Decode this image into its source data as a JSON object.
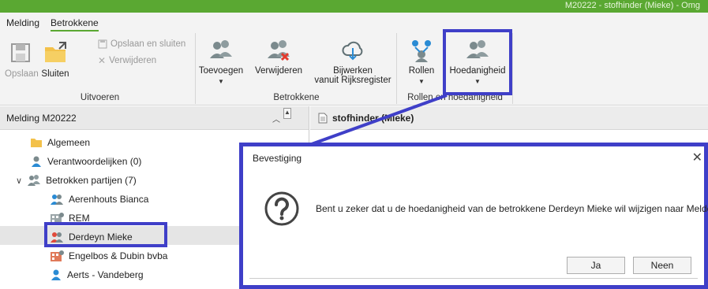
{
  "window": {
    "title": "M20222 - stofhinder (Mieke) - Omg"
  },
  "ribbon": {
    "tabs": [
      {
        "label": "Melding"
      },
      {
        "label": "Betrokkene"
      }
    ],
    "uitvoeren": {
      "group_label": "Uitvoeren",
      "opslaan": "Opslaan",
      "sluiten": "Sluiten",
      "opslaan_en_sluiten": "Opslaan en sluiten",
      "verwijderen": "Verwijderen"
    },
    "betrokkene": {
      "group_label": "Betrokkene",
      "toevoegen": "Toevoegen",
      "verwijderen": "Verwijderen",
      "bijwerken_line1": "Bijwerken",
      "bijwerken_line2": "vanuit Rijksregister"
    },
    "rollen_group": {
      "group_label": "Rollen en hoedanigheid",
      "rollen": "Rollen",
      "hoedanigheid": "Hoedanigheid"
    }
  },
  "nav": {
    "header": "Melding M20222",
    "items": [
      {
        "label": "Algemeen"
      },
      {
        "label": "Verantwoordelijken (0)"
      },
      {
        "label": "Betrokken partijen (7)"
      },
      {
        "label": "Aerenhouts Bianca"
      },
      {
        "label": "REM"
      },
      {
        "label": "Derdeyn Mieke"
      },
      {
        "label": "Engelbos & Dubin bvba"
      },
      {
        "label": "Aerts - Vandeberg"
      }
    ]
  },
  "content": {
    "header": "stofhinder (Mieke)"
  },
  "dialog": {
    "title": "Bevestiging",
    "message": "Bent u zeker dat u de hoedanigheid van de betrokkene Derdeyn Mieke wil wijzigen naar Melder?",
    "ja": "Ja",
    "neen": "Neen"
  },
  "colors": {
    "brand_green": "#5aa832",
    "highlight_blue": "#3f3fc8"
  }
}
